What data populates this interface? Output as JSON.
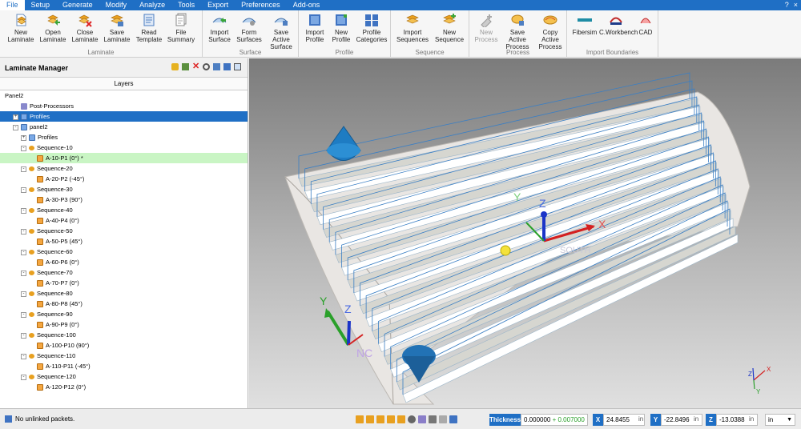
{
  "menu": [
    "File",
    "Setup",
    "Generate",
    "Modify",
    "Analyze",
    "Tools",
    "Export",
    "Preferences",
    "Add-ons"
  ],
  "window_controls": [
    "?",
    "×"
  ],
  "ribbon": {
    "groups": [
      {
        "name": "Laminate",
        "buttons": [
          "New Laminate",
          "Open Laminate",
          "Close Laminate",
          "Save Laminate",
          "Read Template",
          "File Summary"
        ]
      },
      {
        "name": "Surface",
        "buttons": [
          "Import Surface",
          "Form Surfaces",
          "Save Active Surface"
        ]
      },
      {
        "name": "Profile",
        "buttons": [
          "Import Profile",
          "New Profile",
          "Profile Categories"
        ]
      },
      {
        "name": "Sequence",
        "buttons": [
          "Import Sequences",
          "New Sequence"
        ]
      },
      {
        "name": "Process",
        "buttons": [
          "New Process",
          "Save Active Process",
          "Copy Active Process"
        ]
      },
      {
        "name": "Import Boundaries",
        "buttons": [
          "Fibersim",
          "C.Workbench",
          "CAD"
        ]
      }
    ]
  },
  "panel": {
    "title": "Laminate Manager",
    "layers_header": "Layers",
    "tree": [
      {
        "label": "Panel2",
        "indent": 0,
        "type": "root"
      },
      {
        "label": "Post-Processors",
        "indent": 1,
        "type": "post"
      },
      {
        "label": "Profiles",
        "indent": 1,
        "type": "prof",
        "selected": true,
        "expander": "+"
      },
      {
        "label": "panel2",
        "indent": 1,
        "type": "surf",
        "expander": "-"
      },
      {
        "label": "Profiles",
        "indent": 2,
        "type": "prof",
        "expander": "+"
      },
      {
        "label": "Sequence-10",
        "indent": 2,
        "type": "seq",
        "expander": "-"
      },
      {
        "label": "A-10-P1 (0°) *",
        "indent": 3,
        "type": "ply",
        "highlight": true
      },
      {
        "label": "Sequence-20",
        "indent": 2,
        "type": "seq",
        "expander": "-"
      },
      {
        "label": "A-20-P2 (-45°)",
        "indent": 3,
        "type": "ply"
      },
      {
        "label": "Sequence-30",
        "indent": 2,
        "type": "seq",
        "expander": "-"
      },
      {
        "label": "A-30-P3 (90°)",
        "indent": 3,
        "type": "ply"
      },
      {
        "label": "Sequence-40",
        "indent": 2,
        "type": "seq",
        "expander": "-"
      },
      {
        "label": "A-40-P4 (0°)",
        "indent": 3,
        "type": "ply"
      },
      {
        "label": "Sequence-50",
        "indent": 2,
        "type": "seq",
        "expander": "-"
      },
      {
        "label": "A-50-P5 (45°)",
        "indent": 3,
        "type": "ply"
      },
      {
        "label": "Sequence-60",
        "indent": 2,
        "type": "seq",
        "expander": "-"
      },
      {
        "label": "A-60-P6 (0°)",
        "indent": 3,
        "type": "ply"
      },
      {
        "label": "Sequence-70",
        "indent": 2,
        "type": "seq",
        "expander": "-"
      },
      {
        "label": "A-70-P7 (0°)",
        "indent": 3,
        "type": "ply"
      },
      {
        "label": "Sequence-80",
        "indent": 2,
        "type": "seq",
        "expander": "-"
      },
      {
        "label": "A-80-P8 (45°)",
        "indent": 3,
        "type": "ply"
      },
      {
        "label": "Sequence-90",
        "indent": 2,
        "type": "seq",
        "expander": "-"
      },
      {
        "label": "A-90-P9 (0°)",
        "indent": 3,
        "type": "ply"
      },
      {
        "label": "Sequence-100",
        "indent": 2,
        "type": "seq",
        "expander": "-"
      },
      {
        "label": "A-100-P10 (90°)",
        "indent": 3,
        "type": "ply"
      },
      {
        "label": "Sequence-110",
        "indent": 2,
        "type": "seq",
        "expander": "-"
      },
      {
        "label": "A-110-P11 (-45°)",
        "indent": 3,
        "type": "ply"
      },
      {
        "label": "Sequence-120",
        "indent": 2,
        "type": "seq",
        "expander": "-"
      },
      {
        "label": "A-120-P12 (0°)",
        "indent": 3,
        "type": "ply"
      }
    ]
  },
  "viewport": {
    "axis_labels": {
      "x": "X",
      "y": "Y",
      "z": "Z",
      "south": "SOUTH",
      "nc": "NC"
    }
  },
  "status": {
    "message": "No unlinked packets.",
    "thickness_label": "Thickness",
    "thickness_value": "0.000000",
    "thickness_increment": "+ 0.007000",
    "x_label": "X",
    "x_value": "24.8455",
    "x_unit": "in",
    "y_label": "Y",
    "y_value": "-22.8496",
    "y_unit": "in",
    "z_label": "Z",
    "z_value": "-13.0388",
    "z_unit": "in",
    "units_select": "in"
  }
}
